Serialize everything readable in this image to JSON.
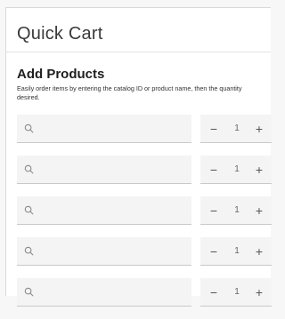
{
  "header": {
    "title": "Quick Cart"
  },
  "add_products": {
    "title": "Add Products",
    "description": "Easily order items by entering the catalog ID or product name, then the quantity desired."
  },
  "rows": [
    {
      "search_value": "",
      "qty": "1",
      "minus": "−",
      "plus": "+"
    },
    {
      "search_value": "",
      "qty": "1",
      "minus": "−",
      "plus": "+"
    },
    {
      "search_value": "",
      "qty": "1",
      "minus": "−",
      "plus": "+"
    },
    {
      "search_value": "",
      "qty": "1",
      "minus": "−",
      "plus": "+"
    },
    {
      "search_value": "",
      "qty": "1",
      "minus": "−",
      "plus": "+"
    }
  ],
  "icons": {
    "search": "search-icon"
  },
  "colors": {
    "field_bg": "#f4f4f4",
    "field_border": "#c9c9c9",
    "icon": "#8a8a8a"
  }
}
